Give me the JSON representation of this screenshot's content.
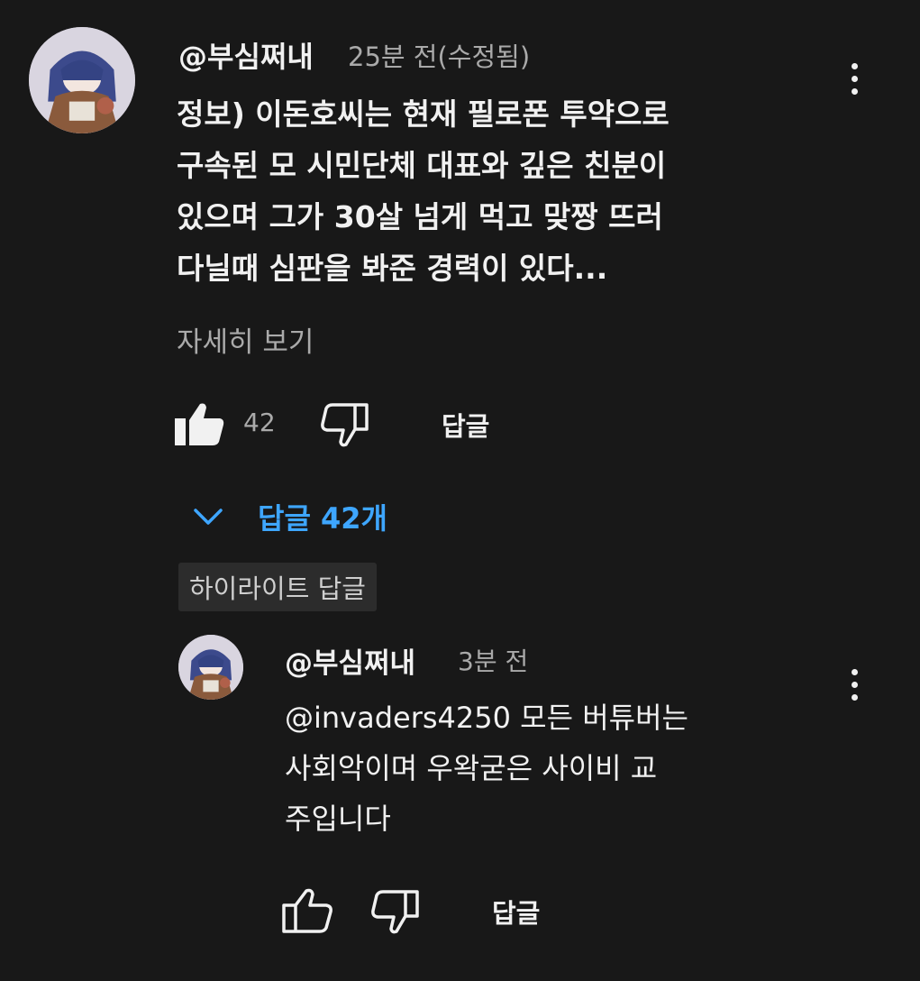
{
  "comment": {
    "username": "@부심쩌내",
    "timestamp": "25분 전(수정됨)",
    "body_lines": [
      "정보) 이돈호씨는 현재 필로폰 투약으로",
      "구속된 모 시민단체 대표와 깊은 친분이",
      "있으며 그가 30살 넘게 먹고 맞짱 뜨러",
      "다닐때 심판을 봐준 경력이 있다..."
    ],
    "read_more": "자세히 보기",
    "like_count": "42",
    "reply_label": "답글",
    "replies_toggle": "답글 42개",
    "highlight_label": "하이라이트 답글",
    "icons": {
      "like": "thumbs-up-filled-icon",
      "dislike": "thumbs-down-icon",
      "more": "more-vertical-icon",
      "toggle": "chevron-down-icon"
    }
  },
  "reply": {
    "username": "@부심쩌내",
    "timestamp": "3분 전",
    "body_lines": [
      "@invaders4250 모든 버튜버는",
      "사회악이며 우왁굳은 사이비 교",
      "주입니다"
    ],
    "reply_label": "답글",
    "icons": {
      "like": "thumbs-up-outline-icon",
      "dislike": "thumbs-down-icon",
      "more": "more-vertical-icon"
    }
  },
  "colors": {
    "background": "#181818",
    "text": "#f1f1f1",
    "secondary": "#aaaaaa",
    "link": "#3ea6ff",
    "chip": "#2c2c2c"
  }
}
